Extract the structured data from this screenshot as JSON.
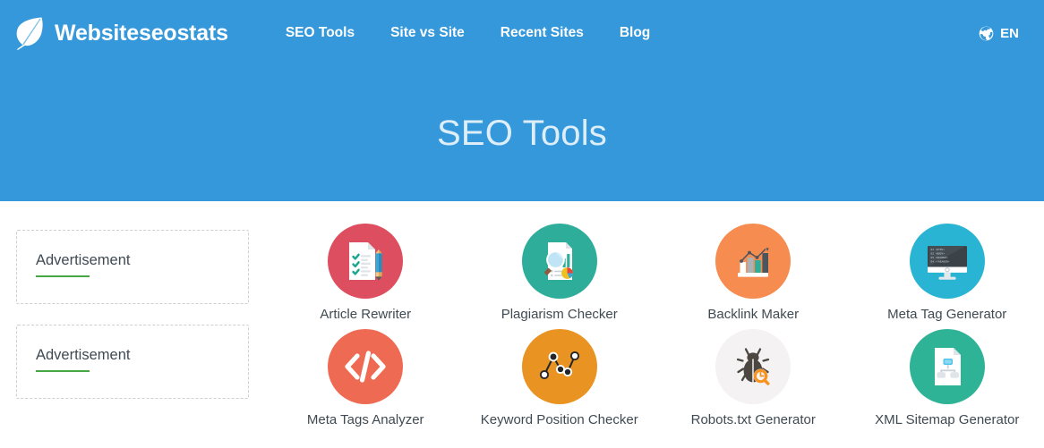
{
  "header": {
    "brand": {
      "name": "Websiteseostats",
      "icon": "leaf-icon"
    },
    "nav": [
      {
        "label": "SEO Tools"
      },
      {
        "label": "Site vs Site"
      },
      {
        "label": "Recent Sites"
      },
      {
        "label": "Blog"
      }
    ],
    "language": {
      "label": "EN",
      "icon": "globe-icon"
    },
    "background_color": "#3498db"
  },
  "hero": {
    "title": "SEO Tools",
    "title_color": "#ddeef9"
  },
  "sidebar": {
    "ads": [
      {
        "label": "Advertisement"
      },
      {
        "label": "Advertisement"
      }
    ],
    "rule_color": "#45a845"
  },
  "tools": [
    {
      "label": "Article Rewriter",
      "icon": "checklist-document-pencil-icon",
      "circle_color": "#dd4e60"
    },
    {
      "label": "Plagiarism Checker",
      "icon": "magnifier-report-icon",
      "circle_color": "#2eae9a"
    },
    {
      "label": "Backlink Maker",
      "icon": "growth-bar-chart-icon",
      "circle_color": "#f68c50"
    },
    {
      "label": "Meta Tag Generator",
      "icon": "monitor-code-icon",
      "circle_color": "#28b4d2",
      "code_lines": [
        "01 <HTML>",
        "02 <BODY>",
        "03 <HEADER>",
        "04 </HEADER>"
      ]
    },
    {
      "label": "Meta Tags Analyzer",
      "icon": "code-brackets-icon",
      "circle_color": "#ef6a52"
    },
    {
      "label": "Keyword Position Checker",
      "icon": "line-graph-nodes-icon",
      "circle_color": "#e99322"
    },
    {
      "label": "Robots.txt Generator",
      "icon": "bug-magnifier-icon",
      "circle_color": "#f4f2f2"
    },
    {
      "label": "XML Sitemap Generator",
      "icon": "sitemap-document-icon",
      "circle_color": "#2eb396"
    }
  ]
}
